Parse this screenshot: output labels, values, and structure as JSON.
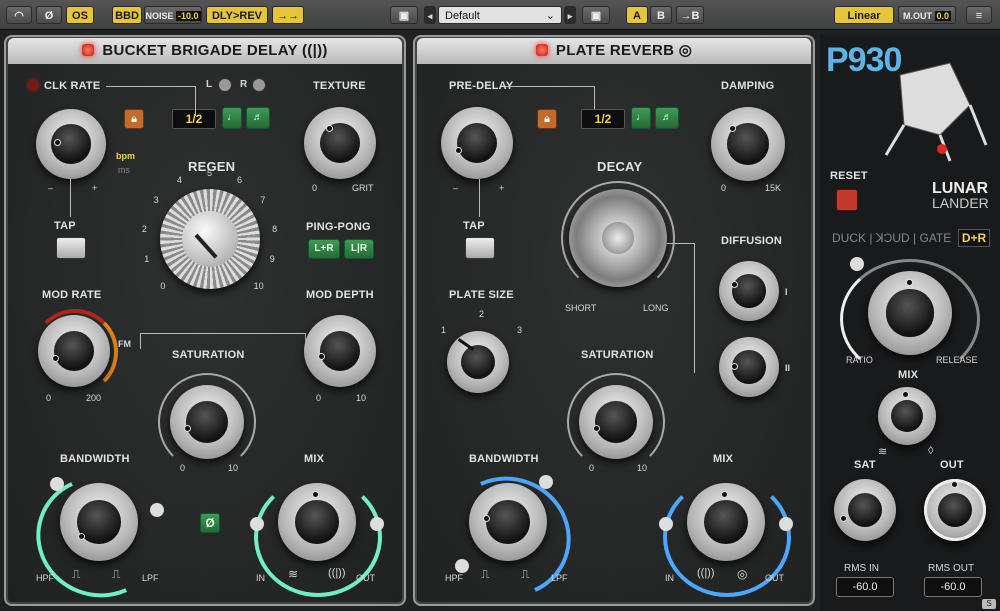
{
  "topbar": {
    "power_icon": "power-icon",
    "phase_label": "Ø",
    "os_label": "OS",
    "bbd_label": "BBD",
    "noise_label": "NOISE",
    "noise_value": "-10.0",
    "dly_rev_label": "DLY>REV",
    "route_label": "→→",
    "preset_name": "Default",
    "a_label": "A",
    "b_label": "B",
    "copy_label": "→B",
    "mode_label": "Linear",
    "mout_label": "M.OUT",
    "mout_value": "0.0"
  },
  "delay": {
    "title": "BUCKET BRIGADE DELAY",
    "title_icon": "((|))",
    "clk_rate": "CLK RATE",
    "l_label": "L",
    "r_label": "R",
    "sync_value": "1/2",
    "texture": "TEXTURE",
    "texture_min": "0",
    "texture_max": "GRIT",
    "bpm": "bpm",
    "ms": "ms",
    "minus": "–",
    "plus": "+",
    "regen": "REGEN",
    "regen_ticks": [
      "0",
      "1",
      "2",
      "3",
      "4",
      "5",
      "6",
      "7",
      "8",
      "9",
      "10"
    ],
    "tap": "TAP",
    "ping_pong": "PING-PONG",
    "lr_plus": "L+R",
    "lr_bar": "L|R",
    "mod_rate": "MOD RATE",
    "mod_rate_min": "0",
    "mod_rate_max": "200",
    "fm": "FM",
    "mod_depth": "MOD DEPTH",
    "mod_depth_min": "0",
    "mod_depth_max": "10",
    "saturation": "SATURATION",
    "sat_min": "0",
    "sat_max": "10",
    "bandwidth": "BANDWIDTH",
    "hpf": "HPF",
    "lpf": "LPF",
    "phase": "Ø",
    "mix": "MIX",
    "in": "IN",
    "out": "OUT"
  },
  "reverb": {
    "title": "PLATE REVERB",
    "pre_delay": "PRE-DELAY",
    "sync_value": "1/2",
    "damping": "DAMPING",
    "damping_min": "0",
    "damping_max": "15K",
    "minus": "–",
    "plus": "+",
    "decay": "DECAY",
    "short": "SHORT",
    "long": "LONG",
    "tap": "TAP",
    "diffusion": "DIFFUSION",
    "diff_i": "I",
    "diff_ii": "II",
    "plate_size": "PLATE SIZE",
    "ps_1": "1",
    "ps_2": "2",
    "ps_3": "3",
    "saturation": "SATURATION",
    "sat_min": "0",
    "sat_max": "10",
    "bandwidth": "BANDWIDTH",
    "hpf": "HPF",
    "lpf": "LPF",
    "mix": "MIX",
    "in": "IN",
    "out": "OUT"
  },
  "side": {
    "brand": "P930",
    "lunar": "LUNAR",
    "lander": "LANDER",
    "reset": "RESET",
    "duck": "DUCK",
    "kcud": "ꓘƆUD",
    "gate": "GATE",
    "dr": "D+R",
    "ratio": "RATIO",
    "release": "RELEASE",
    "mix": "MIX",
    "sat": "SAT",
    "out": "OUT",
    "rms_in": "RMS IN",
    "rms_in_value": "-60.0",
    "rms_out": "RMS OUT",
    "rms_out_value": "-60.0"
  },
  "colors": {
    "accent_yellow": "#e6c53a",
    "green_button": "#2f8a46",
    "lock_orange": "#c36b2a",
    "led_red": "#e0281c",
    "mint_arc": "#6ff0c0",
    "blue_arc": "#4da6ff",
    "mod_arc": "#e0831c"
  }
}
